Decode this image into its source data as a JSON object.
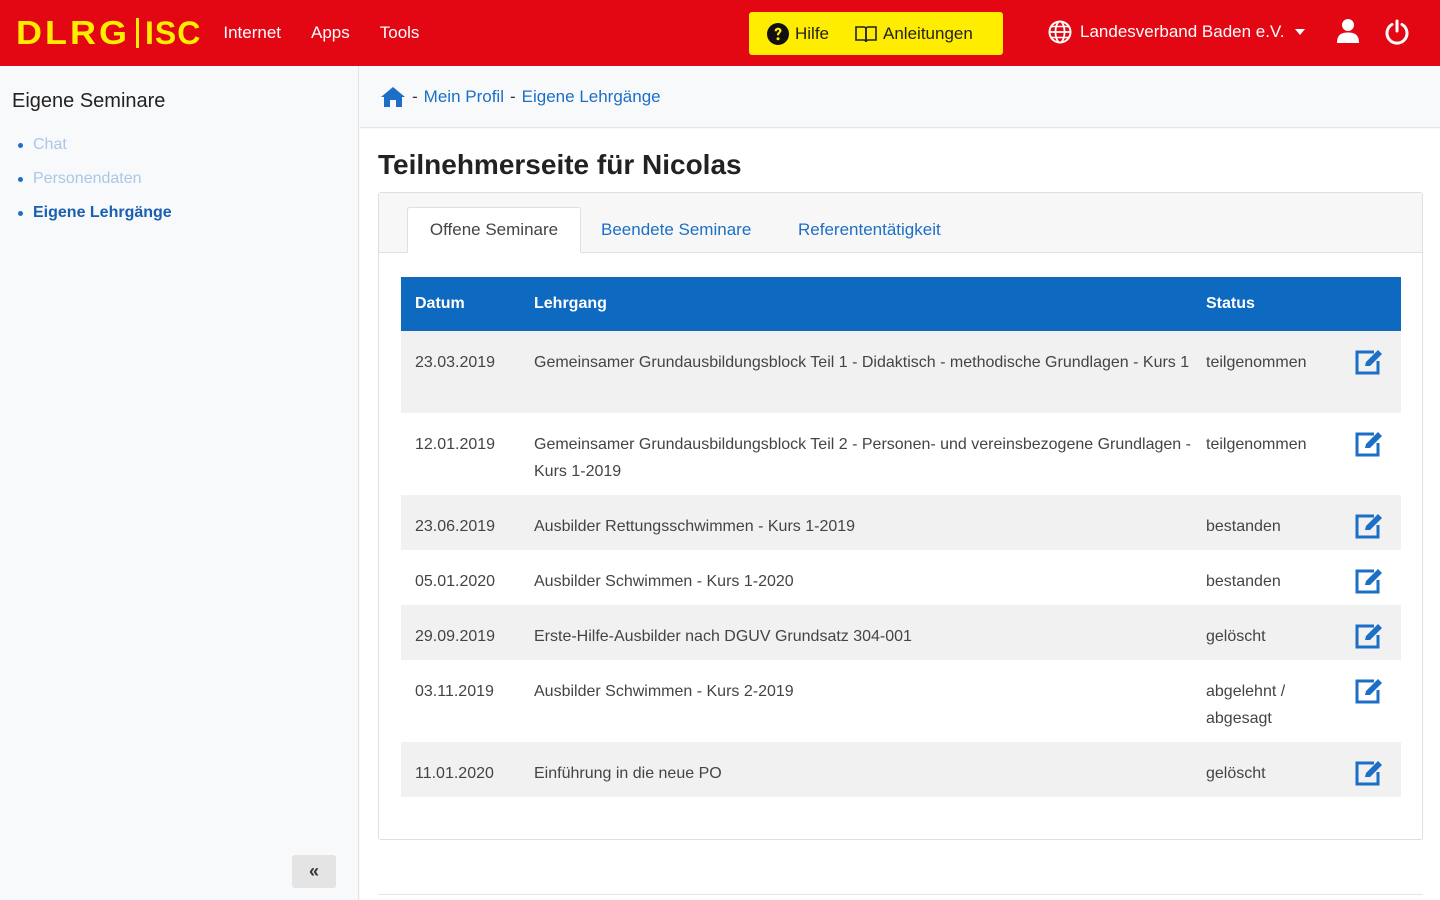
{
  "brand": {
    "dlrg": "DLRG",
    "isc": "ISC"
  },
  "nav": {
    "items": [
      {
        "label": "Internet"
      },
      {
        "label": "Apps"
      },
      {
        "label": "Tools"
      }
    ]
  },
  "help": {
    "hilfe_label": "Hilfe",
    "anleitungen_label": "Anleitungen"
  },
  "org": {
    "label": "Landesverband Baden e.V."
  },
  "sidebar": {
    "title": "Eigene Seminare",
    "items": [
      {
        "label": "Chat"
      },
      {
        "label": "Personendaten"
      },
      {
        "label": "Eigene Lehrgänge"
      }
    ],
    "collapse_label": "«"
  },
  "breadcrumb": {
    "sep": "-",
    "items": [
      {
        "label": "Mein Profil"
      },
      {
        "label": "Eigene Lehrgänge"
      }
    ]
  },
  "page": {
    "title": "Teilnehmerseite für Nicolas"
  },
  "tabs": [
    {
      "label": "Offene Seminare"
    },
    {
      "label": "Beendete Seminare"
    },
    {
      "label": "Referententätigkeit"
    }
  ],
  "table": {
    "headers": {
      "datum": "Datum",
      "lehrgang": "Lehrgang",
      "status": "Status"
    },
    "rows": [
      {
        "datum": "23.03.2019",
        "lehrgang": "Gemeinsamer Grundausbildungsblock Teil 1 - Didaktisch - methodische Grundlagen - Kurs 1",
        "status": "teilgenommen"
      },
      {
        "datum": "12.01.2019",
        "lehrgang": "Gemeinsamer Grundausbildungsblock Teil 2 - Personen- und vereinsbezogene Grundlagen - Kurs 1-2019",
        "status": "teilgenommen"
      },
      {
        "datum": "23.06.2019",
        "lehrgang": "Ausbilder Rettungsschwimmen - Kurs 1-2019",
        "status": "bestanden"
      },
      {
        "datum": "05.01.2020",
        "lehrgang": "Ausbilder Schwimmen - Kurs 1-2020",
        "status": "bestanden"
      },
      {
        "datum": "29.09.2019",
        "lehrgang": "Erste-Hilfe-Ausbilder nach DGUV Grundsatz 304-001",
        "status": "gelöscht"
      },
      {
        "datum": "03.11.2019",
        "lehrgang": "Ausbilder Schwimmen - Kurs 2-2019",
        "status": "abgelehnt / abgesagt"
      },
      {
        "datum": "11.01.2020",
        "lehrgang": "Einführung in die neue PO",
        "status": "gelöscht"
      }
    ]
  },
  "colors": {
    "brand_red": "#e30613",
    "brand_yellow": "#ffed00",
    "table_header": "#0d6ac0",
    "link": "#1c6fc6"
  },
  "icons": {
    "help": "question-circle-icon",
    "manual": "book-icon",
    "globe": "globe-icon",
    "user": "user-icon",
    "power": "power-icon",
    "home": "home-icon",
    "edit": "edit-icon"
  }
}
